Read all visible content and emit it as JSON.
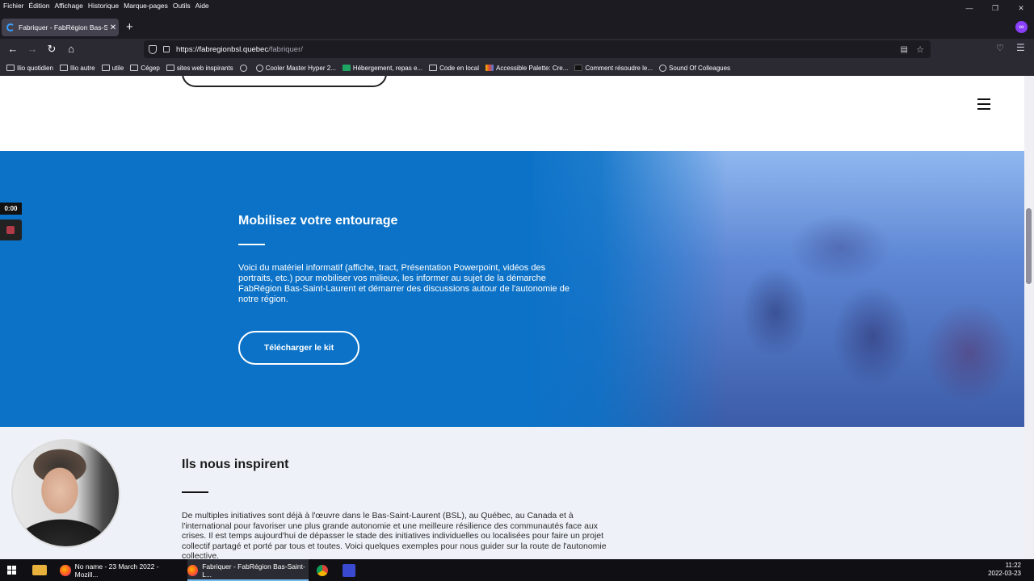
{
  "menubar": [
    "Fichier",
    "Édition",
    "Affichage",
    "Historique",
    "Marque-pages",
    "Outils",
    "Aide"
  ],
  "window_controls": {
    "minimize": "—",
    "restore": "❐",
    "close": "✕"
  },
  "tab": {
    "title": "Fabriquer - FabRégion Bas-Saint-Laurent",
    "close": "✕"
  },
  "new_tab": "+",
  "nav": {
    "back": "←",
    "forward": "→",
    "reload": "↻",
    "home": "⌂"
  },
  "url": {
    "host": "https://fabregionbsl.quebec",
    "path": "/fabriquer/"
  },
  "bookmarks": [
    {
      "label": "Ilio quotidien",
      "icon": "folder-icon"
    },
    {
      "label": "Ilio autre",
      "icon": "folder-icon"
    },
    {
      "label": "utile",
      "icon": "folder-icon"
    },
    {
      "label": "Cégep",
      "icon": "folder-icon"
    },
    {
      "label": "sites web inspirants",
      "icon": "folder-icon"
    },
    {
      "label": "",
      "icon": "site-icon"
    },
    {
      "label": "Cooler Master Hyper 2...",
      "icon": "site-icon"
    },
    {
      "label": "Hébergement, repas e...",
      "icon": "sheets-icon"
    },
    {
      "label": "Code en local",
      "icon": "folder-icon"
    },
    {
      "label": "Accessible Palette: Cre...",
      "icon": "palette-icon"
    },
    {
      "label": "Comment résoudre le...",
      "icon": "site-icon"
    },
    {
      "label": "Sound Of Colleagues",
      "icon": "globe-icon"
    }
  ],
  "hero": {
    "title": "Mobilisez votre entourage",
    "text": "Voici du matériel informatif (affiche, tract, Présentation Powerpoint, vidéos des portraits, etc.) pour mobiliser vos milieux, les informer au sujet de la démarche FabRégion Bas-Saint-Laurent et démarrer des discussions autour de l'autonomie de notre région.",
    "button": "Télécharger le kit"
  },
  "section2": {
    "title": "Ils nous inspirent",
    "text": "De multiples initiatives sont déjà à l'œuvre dans le Bas-Saint-Laurent (BSL), au Québec, au Canada et à l'international pour favoriser une plus grande autonomie et une meilleure résilience des communautés face aux crises. Il est temps aujourd'hui de dépasser le stade des initiatives individuelles ou localisées pour faire un projet collectif partagé et porté par tous et toutes. Voici quelques exemples pour nous guider sur la route de l'autonomie collective."
  },
  "recorder": {
    "time": "0:00"
  },
  "taskbar": {
    "app1": "No name - 23 March 2022 - Mozill...",
    "app2": "Fabriquer - FabRégion Bas-Saint-L...",
    "time": "11:22",
    "date": "2022-03-23"
  },
  "colors": {
    "hero_blue": "#0b72c7",
    "section_bg": "#eef2f8",
    "browser_dark": "#1c1b22"
  }
}
